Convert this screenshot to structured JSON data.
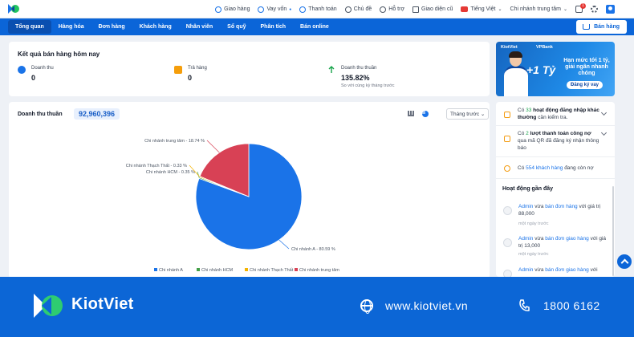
{
  "topbar": {
    "items": [
      {
        "label": "Giao hàng",
        "icon": "truck-icon"
      },
      {
        "label": "Vay vốn",
        "icon": "money-icon"
      },
      {
        "label": "Thanh toán",
        "icon": "payment-icon"
      },
      {
        "label": "Chủ đề",
        "icon": "palette-icon"
      },
      {
        "label": "Hỗ trợ",
        "icon": "support-icon"
      },
      {
        "label": "Giao diện cũ",
        "icon": "monitor-icon"
      },
      {
        "label": "Tiếng Việt",
        "icon": "vn-flag-icon"
      },
      {
        "label": "Chi nhánh trung tâm",
        "icon": "chevron-down-icon"
      }
    ],
    "notification_count": "1"
  },
  "nav": {
    "items": [
      "Tổng quan",
      "Hàng hóa",
      "Đơn hàng",
      "Khách hàng",
      "Nhân viên",
      "Sổ quỹ",
      "Phân tích",
      "Bán online"
    ],
    "active_index": 0,
    "sell_label": "Bán hàng"
  },
  "summary": {
    "title": "Kết quả bán hàng hôm nay",
    "revenue_label": "Doanh thu",
    "revenue_value": "0",
    "returns_label": "Trả hàng",
    "returns_value": "0",
    "net_label": "Doanh thu thuần",
    "net_value": "135.82%",
    "net_sub": "So với cùng kỳ tháng trước"
  },
  "revenue": {
    "title": "Doanh thu thuần",
    "total": "92,960,396",
    "period": "Tháng trước"
  },
  "chart_data": {
    "type": "pie",
    "categories": [
      "Chi nhánh A",
      "Chi nhánh HCM",
      "Chi nhánh Thạch Thất",
      "Chi nhánh trung tâm"
    ],
    "values": [
      80.59,
      0.35,
      0.33,
      18.74
    ],
    "slice_labels": [
      "Chi nhánh A - 80.59 %",
      "Chi nhánh HCM - 0.35 %",
      "Chi nhánh Thạch Thất - 0.33 %",
      "Chi nhánh trung tâm - 18.74 %"
    ],
    "colors": [
      "#1a73e8",
      "#43a047",
      "#f4b400",
      "#d84155"
    ],
    "legend_position": "bottom"
  },
  "banner": {
    "brand": "KiotViet",
    "partner": "VPBank",
    "big": "+1 Tỷ",
    "text": "Hạn mức tới 1 tỷ, giải ngân nhanh chóng",
    "cta": "Đăng ký vay"
  },
  "notices": [
    {
      "pre": "Có ",
      "num": "33",
      "mid": " hoạt động đăng nhập khác thường",
      "post": " cần kiểm tra."
    },
    {
      "pre": "Có ",
      "num": "2",
      "mid": " lượt thanh toán công nợ",
      "post": " qua mã QR đã đăng ký nhận thông báo"
    },
    {
      "pre": "Có ",
      "num": "554 khách hàng",
      "mid": "",
      "post": " đang còn nợ"
    }
  ],
  "activity": {
    "title": "Hoạt động gần đây",
    "items": [
      {
        "user": "Admin",
        "verb": " vừa ",
        "action": "bán đơn hàng",
        "rest": " với giá trị 88,000",
        "time": "một ngày trước"
      },
      {
        "user": "Admin",
        "verb": " vừa ",
        "action": "bán đơn giao hàng",
        "rest": " với giá trị 13,000",
        "time": "một ngày trước"
      },
      {
        "user": "Admin",
        "verb": " vừa ",
        "action": "bán đơn giao hàng",
        "rest": " với",
        "time": ""
      }
    ]
  },
  "footer": {
    "brand": "KiotViet",
    "website": "www.kiotviet.vn",
    "phone": "1800 6162"
  }
}
